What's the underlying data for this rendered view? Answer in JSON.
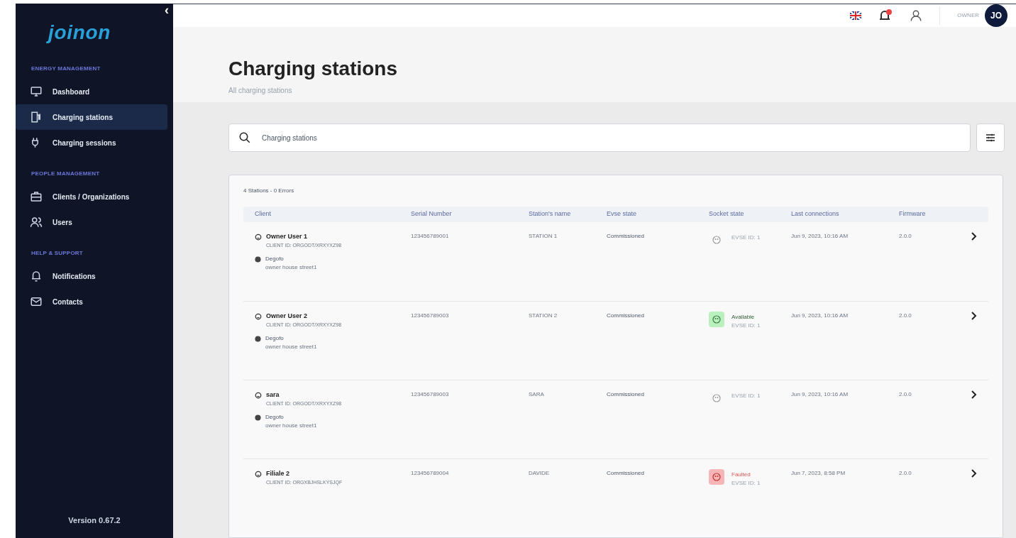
{
  "sidebar": {
    "logo": "joinon",
    "collapse": "‹",
    "sections": [
      {
        "title": "ENERGY MANAGEMENT",
        "items": [
          {
            "label": "Dashboard",
            "selected": false
          },
          {
            "label": "Charging stations",
            "selected": true
          },
          {
            "label": "Charging sessions",
            "selected": false
          }
        ]
      },
      {
        "title": "PEOPLE MANAGEMENT",
        "items": [
          {
            "label": "Clients / Organizations",
            "selected": false
          },
          {
            "label": "Users",
            "selected": false
          }
        ]
      },
      {
        "title": "HELP & SUPPORT",
        "items": [
          {
            "label": "Notifications",
            "selected": false
          },
          {
            "label": "Contacts",
            "selected": false
          }
        ]
      }
    ],
    "version": "Version 0.67.2"
  },
  "topbar": {
    "role": "OWNER",
    "avatar": "JO"
  },
  "header": {
    "title": "Charging stations",
    "subtitle": "All charging stations"
  },
  "search": {
    "value": "Charging stations"
  },
  "table": {
    "summary": "4 Stations - 0 Errors",
    "columns": [
      "Client",
      "Serial Number",
      "Station's name",
      "Evse state",
      "Socket state",
      "Last connections",
      "Firmware"
    ],
    "rows": [
      {
        "client": "Owner User 1",
        "client_id": "CLIENT ID: ORGODT/XRXYXZ98",
        "org": "Degofo",
        "address": "owner house street1",
        "serial": "123456789001",
        "name": "STATION 1",
        "evse_state": "Commissioned",
        "socket": {
          "kind": "none",
          "evse": "EVSE ID: 1"
        },
        "last": "Jun 9, 2023, 10:16 AM",
        "firmware": "2.0.0"
      },
      {
        "client": "Owner User 2",
        "client_id": "CLIENT ID: ORGODT/XRXYXZ98",
        "org": "Degofo",
        "address": "owner house street1",
        "serial": "123456789003",
        "name": "STATION 2",
        "evse_state": "Commissioned",
        "socket": {
          "kind": "available",
          "label": "Available",
          "evse": "EVSE ID: 1"
        },
        "last": "Jun 9, 2023, 10:16 AM",
        "firmware": "2.0.0"
      },
      {
        "client": "sara",
        "client_id": "CLIENT ID: ORGODT/XRXYXZ98",
        "org": "Degofo",
        "address": "owner house street1",
        "serial": "123456789003",
        "name": "SARA",
        "evse_state": "Commissioned",
        "socket": {
          "kind": "none",
          "evse": "EVSE ID: 1"
        },
        "last": "Jun 9, 2023, 10:16 AM",
        "firmware": "2.0.0"
      },
      {
        "client": "Filiale 2",
        "client_id": "CLIENT ID: ORGXBJHSLKYSJQF",
        "serial": "123456789004",
        "name": "DAVIDE",
        "evse_state": "Commissioned",
        "socket": {
          "kind": "faulted",
          "label": "Faulted",
          "evse": "EVSE ID: 1"
        },
        "last": "Jun 7, 2023, 8:58 PM",
        "firmware": "2.0.0"
      }
    ]
  }
}
